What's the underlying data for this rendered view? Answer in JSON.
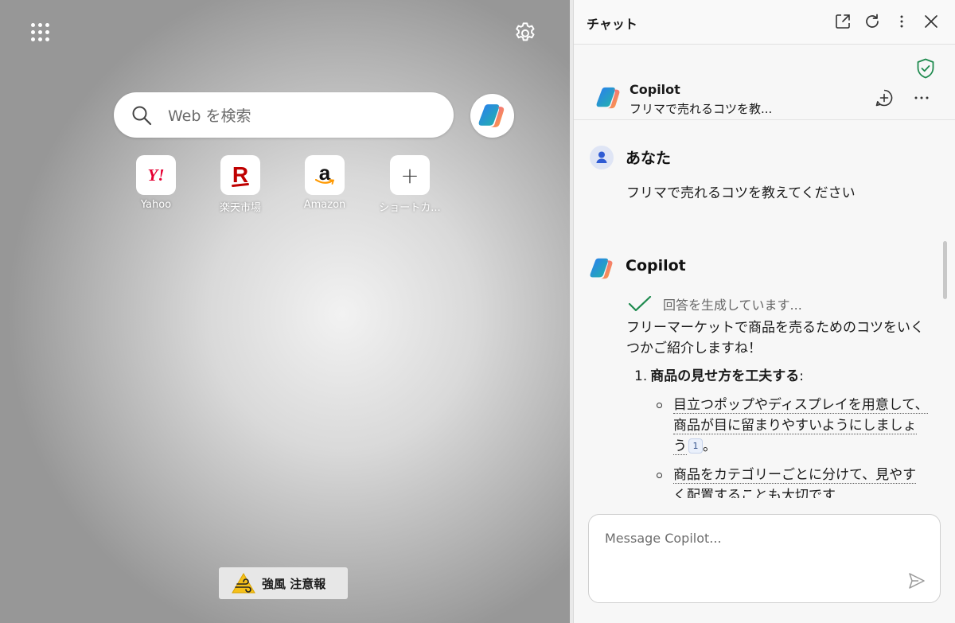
{
  "newtab": {
    "search": {
      "placeholder": "Web を検索"
    },
    "shortcuts": [
      {
        "label": "Yahoo",
        "icon": "yahoo-logo",
        "glyph": "Y!"
      },
      {
        "label": "楽天市場",
        "icon": "rakuten-logo",
        "glyph": "R"
      },
      {
        "label": "Amazon",
        "icon": "amazon-logo",
        "glyph": "a"
      },
      {
        "label": "ショートカ...",
        "icon": "plus-icon",
        "glyph": "+"
      }
    ],
    "weather_alert": {
      "label": "強風 注意報",
      "icon": "wind-warning-icon"
    }
  },
  "chat": {
    "header": {
      "title": "チャット"
    },
    "conversation": {
      "name": "Copilot",
      "subtitle": "フリマで売れるコツを教..."
    },
    "messages": {
      "user": {
        "sender": "あなた",
        "text": "フリマで売れるコツを教えてください"
      },
      "bot": {
        "sender": "Copilot",
        "status": "回答を生成しています...",
        "intro": "フリーマーケットで商品を売るためのコツをいくつかご紹介しますね！",
        "list": [
          {
            "number": "1.",
            "title": "商品の見せ方を工夫する",
            "suffix": ":",
            "bullets": [
              {
                "text": "目立つポップやディスプレイを用意して、商品が目に留まりやすいようにしましょう",
                "cite": "1",
                "end": "。"
              },
              {
                "text": "商品をカテゴリーごとに分けて、見やすく配置することも大切です",
                "cite": "",
                "end": ""
              }
            ]
          }
        ]
      }
    },
    "composer": {
      "placeholder": "Message Copilot..."
    }
  },
  "colors": {
    "accent_green": "#1e8a4e",
    "yahoo_red": "#e60033",
    "rakuten_red": "#bf0000",
    "amazon_orange": "#ff9900"
  }
}
